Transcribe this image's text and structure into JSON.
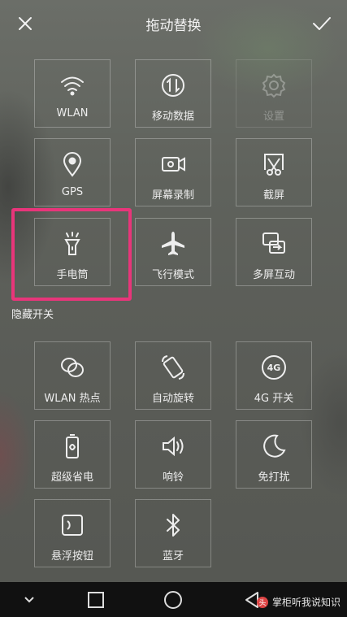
{
  "header": {
    "title": "拖动替换"
  },
  "active_tiles": [
    {
      "label": "WLAN",
      "icon": "wifi-icon",
      "enabled": true
    },
    {
      "label": "移动数据",
      "icon": "mobile-data-icon",
      "enabled": true
    },
    {
      "label": "设置",
      "icon": "gear-icon",
      "enabled": false
    },
    {
      "label": "GPS",
      "icon": "location-pin-icon",
      "enabled": true
    },
    {
      "label": "屏幕录制",
      "icon": "screen-record-icon",
      "enabled": true
    },
    {
      "label": "截屏",
      "icon": "screenshot-icon",
      "enabled": true
    },
    {
      "label": "手电筒",
      "icon": "flashlight-icon",
      "enabled": true
    },
    {
      "label": "飞行模式",
      "icon": "airplane-icon",
      "enabled": true
    },
    {
      "label": "多屏互动",
      "icon": "multi-screen-icon",
      "enabled": true
    }
  ],
  "hidden_section": {
    "label": "隐藏开关"
  },
  "hidden_tiles": [
    {
      "label": "WLAN 热点",
      "icon": "hotspot-icon"
    },
    {
      "label": "自动旋转",
      "icon": "auto-rotate-icon"
    },
    {
      "label": "4G 开关",
      "icon": "4g-icon",
      "icon_text": "4G"
    },
    {
      "label": "超级省电",
      "icon": "battery-saver-icon"
    },
    {
      "label": "响铃",
      "icon": "speaker-icon"
    },
    {
      "label": "免打扰",
      "icon": "moon-icon"
    },
    {
      "label": "悬浮按钮",
      "icon": "floating-button-icon"
    },
    {
      "label": "蓝牙",
      "icon": "bluetooth-icon"
    }
  ],
  "highlight_color": "#e8357a",
  "watermark": {
    "text": "掌柜听我说知识"
  }
}
